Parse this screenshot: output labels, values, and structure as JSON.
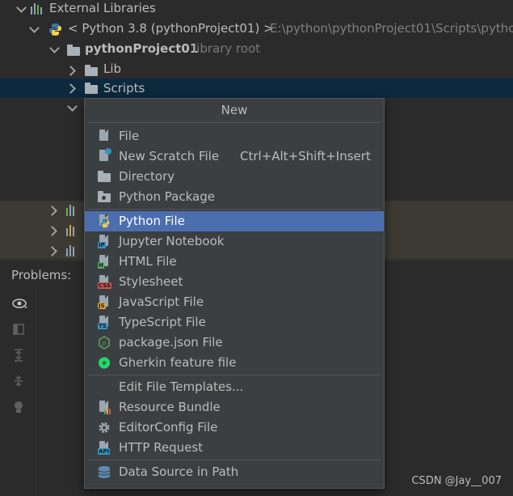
{
  "tree": {
    "external_libraries": "External Libraries",
    "python_sdk": "< Python 3.8 (pythonProject01) >",
    "python_path": "E:\\python\\pythonProject01\\Scripts\\pytho",
    "project_root": "pythonProject01",
    "project_root_hint": "library root",
    "lib": "Lib",
    "scripts": "Scripts"
  },
  "problems_tab": "Problems:",
  "menu": {
    "title": "New",
    "items": [
      {
        "label": "File",
        "icon": "file-icon"
      },
      {
        "label": "New Scratch File",
        "shortcut": "Ctrl+Alt+Shift+Insert",
        "icon": "scratch-file-icon"
      },
      {
        "label": "Directory",
        "icon": "folder-icon"
      },
      {
        "label": "Python Package",
        "icon": "package-icon"
      },
      {
        "label": "Python File",
        "icon": "python-icon",
        "highlighted": true
      },
      {
        "label": "Jupyter Notebook",
        "icon": "jupyter-icon",
        "tag": "IP",
        "tag_color": "#3592c4"
      },
      {
        "label": "HTML File",
        "icon": "html-icon",
        "tag": "H",
        "tag_color": "#59a869"
      },
      {
        "label": "Stylesheet",
        "icon": "css-icon",
        "tag": "CSS",
        "tag_color": "#c75450"
      },
      {
        "label": "JavaScript File",
        "icon": "javascript-icon",
        "tag": "JS",
        "tag_color": "#d9a343"
      },
      {
        "label": "TypeScript File",
        "icon": "typescript-icon",
        "tag": "TS",
        "tag_color": "#3592c4"
      },
      {
        "label": "package.json File",
        "icon": "nodejs-icon"
      },
      {
        "label": "Gherkin feature file",
        "icon": "cucumber-icon"
      },
      {
        "label": "Edit File Templates...",
        "icon": ""
      },
      {
        "label": "Resource Bundle",
        "icon": "resource-bundle-icon"
      },
      {
        "label": "EditorConfig File",
        "icon": "gear-icon"
      },
      {
        "label": "HTTP Request",
        "icon": "api-icon",
        "tag": "API",
        "tag_color": "#3592c4"
      },
      {
        "label": "Data Source in Path",
        "icon": "database-icon"
      }
    ]
  },
  "watermark": "CSDN @Jay__007",
  "colors": {
    "background": "#2b2b2b",
    "selection_row": "#0d293e",
    "menu_background": "#3c3f41",
    "menu_highlight": "#4b6eaf",
    "text": "#bbbbbb"
  }
}
